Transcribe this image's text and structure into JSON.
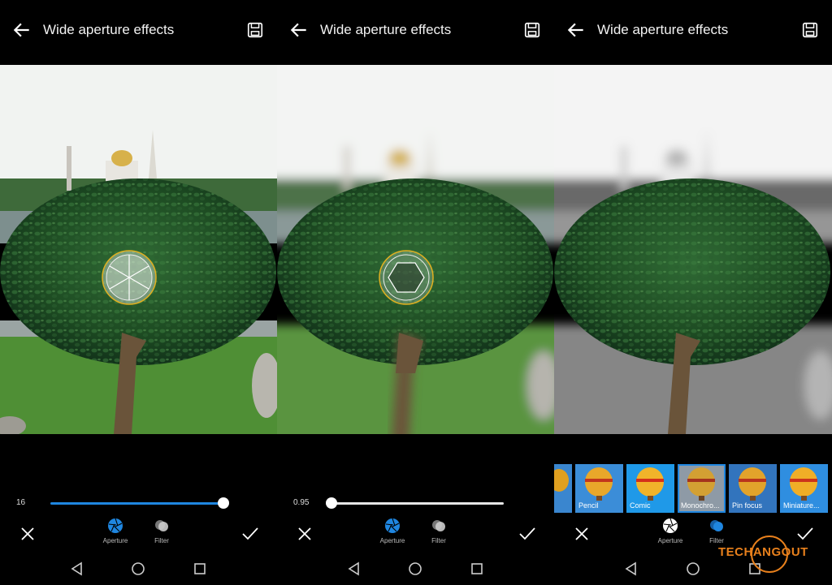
{
  "screens": [
    {
      "title": "Wide aperture effects",
      "slider_value": "16",
      "tools": {
        "aperture_label": "Aperture",
        "filter_label": "Filter"
      }
    },
    {
      "title": "Wide aperture effects",
      "slider_value": "0.95",
      "tools": {
        "aperture_label": "Aperture",
        "filter_label": "Filter"
      }
    },
    {
      "title": "Wide aperture effects",
      "tools": {
        "aperture_label": "Aperture",
        "filter_label": "Filter"
      },
      "filters": [
        "Pencil",
        "Comic",
        "Monochro...",
        "Pin focus",
        "Miniature..."
      ],
      "selected_filter": "Monochro..."
    }
  ],
  "icons": {
    "back": "arrow-left-icon",
    "save": "save-icon",
    "cancel": "close-icon",
    "confirm": "checkmark-icon",
    "aperture": "aperture-icon",
    "filter": "filter-icon",
    "nav_back": "triangle-back-icon",
    "nav_home": "circle-home-icon",
    "nav_recent": "square-recent-icon"
  },
  "colors": {
    "accent": "#1f86e0",
    "focus_ring": "#e0b020",
    "watermark": "#e8801c"
  },
  "watermark": "TECHANGOUT"
}
